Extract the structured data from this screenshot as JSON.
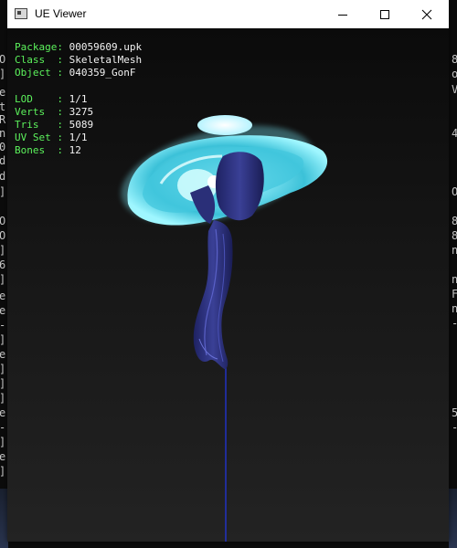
{
  "window": {
    "title": "UE Viewer"
  },
  "info": {
    "package": {
      "label": "Package:",
      "value": "00059609.upk"
    },
    "class": {
      "label": "Class  :",
      "value": "SkeletalMesh"
    },
    "object": {
      "label": "Object :",
      "value": "040359_GonF"
    },
    "lod": {
      "label": "LOD    :",
      "value": "1/1"
    },
    "verts": {
      "label": "Verts  :",
      "value": "3275"
    },
    "tris": {
      "label": "Tris   :",
      "value": "5089"
    },
    "uvset": {
      "label": "UV Set :",
      "value": "1/1"
    },
    "bones": {
      "label": "Bones  :",
      "value": "12"
    }
  },
  "background_console": {
    "left_chars": [
      "O",
      "]",
      "e",
      "t",
      "R",
      "n",
      "0",
      "d",
      "d",
      "]",
      "O",
      "O",
      "]",
      "6",
      "]",
      "e",
      "e",
      "-",
      "]",
      "e",
      "]",
      "]",
      "]",
      "e",
      "-",
      "]",
      "e",
      "]"
    ],
    "right_chars": [
      "8",
      "o",
      "V",
      "4",
      "O",
      "8",
      "8",
      "n",
      "n",
      "F",
      "n",
      "-",
      "5",
      "-"
    ]
  },
  "colors": {
    "label": "#5cf25c",
    "value": "#f2f2f2",
    "glow": "#7ff0ff",
    "mesh": "#2a2f78"
  }
}
